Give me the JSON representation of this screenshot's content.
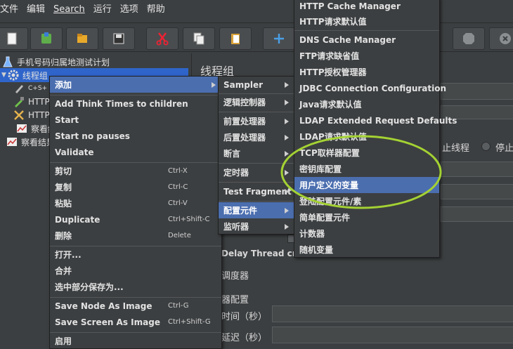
{
  "menubar": [
    "文件",
    "编辑",
    "Search",
    "运行",
    "选项",
    "帮助"
  ],
  "tree": {
    "plan": "手机号码归属地测试计划",
    "group": "线程组",
    "item_csv": "C+S+",
    "item_http1": "HTTP",
    "item_http2": "HTTP",
    "item_view1": "察看结",
    "item_view2": "察看结果"
  },
  "panel": {
    "title": "线程组",
    "stop_thread": "止线程",
    "stop": "停止",
    "delay_thread": "Delay Thread crea",
    "scheduler": "调度器",
    "scheduler_config": "器配置",
    "duration": "时间（秒）",
    "startup_delay": "延迟（秒）"
  },
  "menu1": [
    {
      "label": "添加",
      "accel": "",
      "submenu": true,
      "highlight": true
    },
    {
      "label": "Add Think Times to children",
      "accel": ""
    },
    {
      "label": "Start",
      "accel": ""
    },
    {
      "label": "Start no pauses",
      "accel": ""
    },
    {
      "label": "Validate",
      "accel": ""
    },
    {
      "label": "剪切",
      "accel": "Ctrl-X"
    },
    {
      "label": "复制",
      "accel": "Ctrl-C"
    },
    {
      "label": "粘贴",
      "accel": "Ctrl-V"
    },
    {
      "label": "Duplicate",
      "accel": "Ctrl+Shift-C"
    },
    {
      "label": "删除",
      "accel": "Delete"
    },
    {
      "label": "打开...",
      "accel": ""
    },
    {
      "label": "合并",
      "accel": ""
    },
    {
      "label": "选中部分保存为...",
      "accel": ""
    },
    {
      "label": "Save Node As Image",
      "accel": "Ctrl-G"
    },
    {
      "label": "Save Screen As Image",
      "accel": "Ctrl+Shift-G"
    },
    {
      "label": "启用",
      "accel": ""
    }
  ],
  "menu2": [
    {
      "label": "Sampler"
    },
    {
      "label": "逻辑控制器"
    },
    {
      "label": "前置处理器"
    },
    {
      "label": "后置处理器"
    },
    {
      "label": "断言"
    },
    {
      "label": "定时器"
    },
    {
      "label": "Test Fragment"
    },
    {
      "label": "配置元件"
    },
    {
      "label": "监听器"
    }
  ],
  "menu3": [
    "HTTP Cache Manager",
    "HTTP请求默认值",
    "DNS Cache Manager",
    "FTP请求缺省值",
    "HTTP授权管理器",
    "JDBC Connection Configuration",
    "Java请求默认值",
    "LDAP Extended Request Defaults",
    "LDAP请求默认值",
    "TCP取样器配置",
    "密钥库配置",
    "用户定义的变量",
    "登陆配置元件/素",
    "简单配置元件",
    "计数器",
    "随机变量"
  ]
}
